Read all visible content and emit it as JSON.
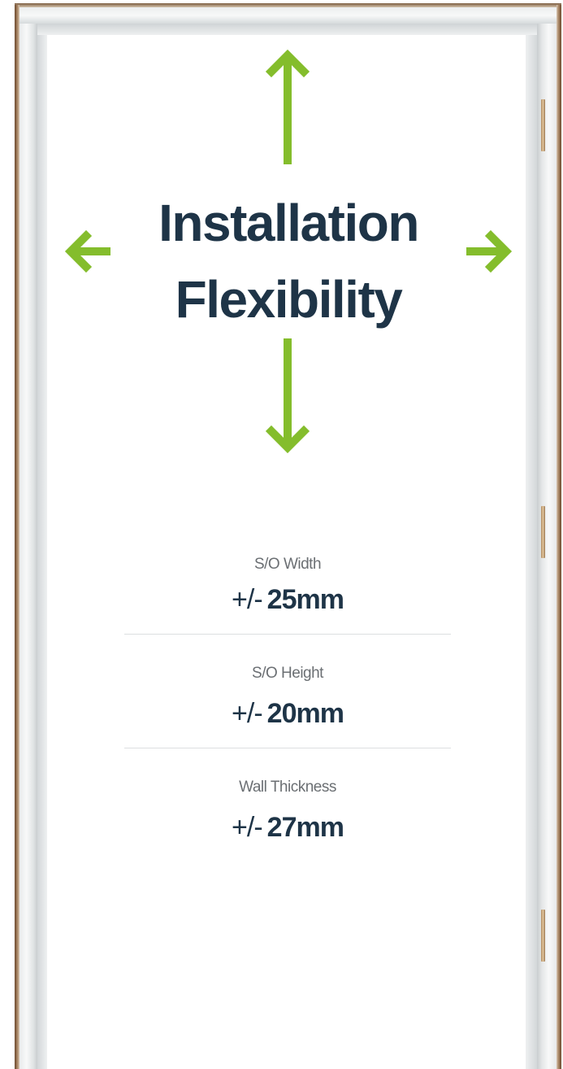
{
  "title": {
    "line1": "Installation",
    "line2": "Flexibility"
  },
  "colors": {
    "title": "#1e3447",
    "arrow": "#84bd2c",
    "label": "#6b6f73",
    "divider": "#dcdfe1"
  },
  "icons": [
    "arrow-up-icon",
    "arrow-down-icon",
    "arrow-left-icon",
    "arrow-right-icon"
  ],
  "specs": [
    {
      "label": "S/O Width",
      "tolerance": "+/-",
      "value": "25mm"
    },
    {
      "label": "S/O Height",
      "tolerance": "+/-",
      "value": "20mm"
    },
    {
      "label": "Wall Thickness",
      "tolerance": "+/-",
      "value": "27mm"
    }
  ]
}
